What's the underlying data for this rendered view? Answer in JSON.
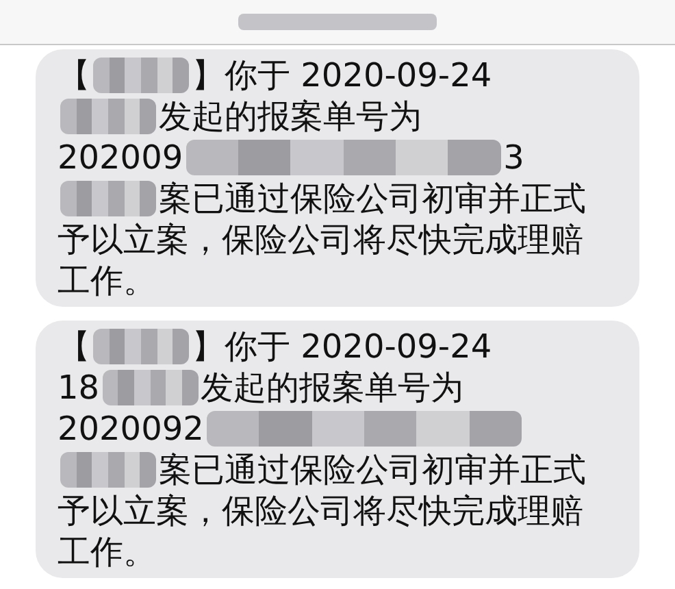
{
  "header": {
    "kind": "redacted"
  },
  "messages": [
    {
      "lines": [
        [
          {
            "kind": "text",
            "text": "【"
          },
          {
            "kind": "redacted"
          },
          {
            "kind": "text",
            "text": "】你于 2020-09-24"
          }
        ],
        [
          {
            "kind": "redacted"
          },
          {
            "kind": "text",
            "text": "发起的报案单号为"
          }
        ],
        [
          {
            "kind": "text",
            "text": "202009"
          },
          {
            "kind": "redacted"
          },
          {
            "kind": "text",
            "text": "3"
          }
        ],
        [
          {
            "kind": "redacted"
          },
          {
            "kind": "text",
            "text": "案已通过保险公司初审并正式"
          }
        ],
        [
          {
            "kind": "text",
            "text": "予以立案，保险公司将尽快完成理赔"
          }
        ],
        [
          {
            "kind": "text",
            "text": "工作。"
          }
        ]
      ]
    },
    {
      "lines": [
        [
          {
            "kind": "text",
            "text": "【"
          },
          {
            "kind": "redacted"
          },
          {
            "kind": "text",
            "text": "】你于 2020-09-24"
          }
        ],
        [
          {
            "kind": "text",
            "text": "18"
          },
          {
            "kind": "redacted"
          },
          {
            "kind": "text",
            "text": "发起的报案单号为"
          }
        ],
        [
          {
            "kind": "text",
            "text": "2020092"
          },
          {
            "kind": "redacted"
          }
        ],
        [
          {
            "kind": "redacted"
          },
          {
            "kind": "text",
            "text": "案已通过保险公司初审并正式"
          }
        ],
        [
          {
            "kind": "text",
            "text": "予以立案，保险公司将尽快完成理赔"
          }
        ],
        [
          {
            "kind": "text",
            "text": "工作。"
          }
        ]
      ]
    }
  ]
}
